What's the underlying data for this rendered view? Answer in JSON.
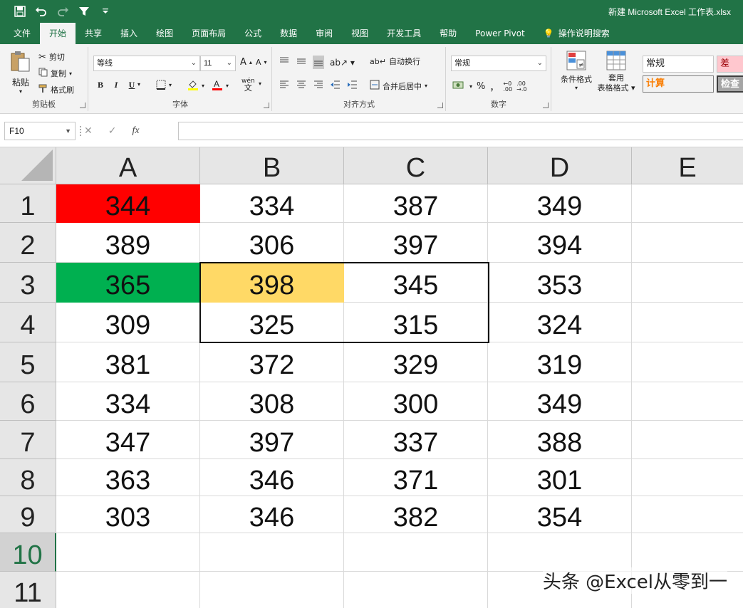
{
  "title_bar": {
    "document_title": "新建 Microsoft Excel 工作表.xlsx",
    "qat_icons": [
      "save-icon",
      "undo-icon",
      "redo-icon",
      "filter-icon",
      "customize-icon"
    ]
  },
  "ribbon_tabs": [
    {
      "label": "文件",
      "active": false
    },
    {
      "label": "开始",
      "active": true
    },
    {
      "label": "共享",
      "active": false
    },
    {
      "label": "插入",
      "active": false
    },
    {
      "label": "绘图",
      "active": false
    },
    {
      "label": "页面布局",
      "active": false
    },
    {
      "label": "公式",
      "active": false
    },
    {
      "label": "数据",
      "active": false
    },
    {
      "label": "审阅",
      "active": false
    },
    {
      "label": "视图",
      "active": false
    },
    {
      "label": "开发工具",
      "active": false
    },
    {
      "label": "帮助",
      "active": false
    },
    {
      "label": "Power Pivot",
      "active": false
    }
  ],
  "tell_me": "操作说明搜索",
  "clipboard": {
    "paste": "粘贴",
    "cut": "剪切",
    "copy": "复制",
    "format_painter": "格式刷",
    "label": "剪贴板"
  },
  "font": {
    "font_name": "等线",
    "font_size": "11",
    "bold": "B",
    "italic": "I",
    "underline": "U",
    "label": "字体",
    "phonetic": "wén",
    "grow": "A",
    "shrink": "A"
  },
  "alignment": {
    "wrap_text": "自动换行",
    "merge_center": "合并后居中",
    "label": "对齐方式"
  },
  "number": {
    "format": "常规",
    "percent": "%",
    "comma": "，",
    "inc_decimal": ".00",
    "label": "数字"
  },
  "styles": {
    "conditional_formatting": "条件格式",
    "format_as_table_line1": "套用",
    "format_as_table_line2": "表格格式",
    "style_normal": "常规",
    "style_bad": "差",
    "style_calc": "计算",
    "style_check": "检查"
  },
  "formula_bar": {
    "name_box": "F10",
    "cancel": "✕",
    "enter": "✓",
    "fx": "fx",
    "formula": ""
  },
  "sheet": {
    "columns": [
      "A",
      "B",
      "C",
      "D",
      "E"
    ],
    "rows": [
      "1",
      "2",
      "3",
      "4",
      "5",
      "6",
      "7",
      "8",
      "9",
      "10",
      "11"
    ],
    "selected_row": "10",
    "data": [
      [
        "344",
        "334",
        "387",
        "349",
        ""
      ],
      [
        "389",
        "306",
        "397",
        "394",
        ""
      ],
      [
        "365",
        "398",
        "345",
        "353",
        ""
      ],
      [
        "309",
        "325",
        "315",
        "324",
        ""
      ],
      [
        "381",
        "372",
        "329",
        "319",
        ""
      ],
      [
        "334",
        "308",
        "300",
        "349",
        ""
      ],
      [
        "347",
        "397",
        "337",
        "388",
        ""
      ],
      [
        "363",
        "346",
        "371",
        "301",
        ""
      ],
      [
        "303",
        "346",
        "382",
        "354",
        ""
      ],
      [
        "",
        "",
        "",
        "",
        ""
      ],
      [
        "",
        "",
        "",
        "",
        ""
      ]
    ],
    "fills": {
      "A1": "#ff0000",
      "A3": "#00b050",
      "B3": "#ffd966"
    },
    "bordered_range": "B3:C4"
  },
  "watermark": "头条 @Excel从零到一",
  "colors": {
    "excel_green": "#217346",
    "ribbon_bg": "#f3f3f3",
    "header_bg": "#e6e6e6"
  }
}
